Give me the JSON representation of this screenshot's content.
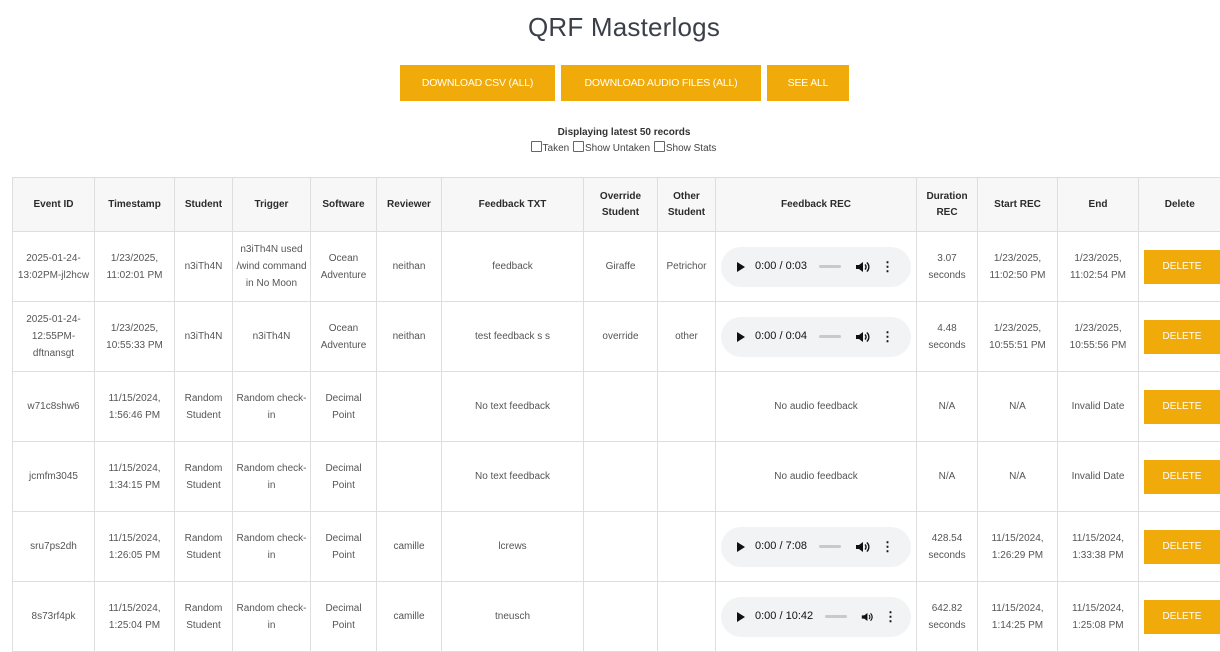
{
  "page": {
    "title": "QRF Masterlogs"
  },
  "toolbar": {
    "download_csv": "DOWNLOAD CSV (ALL)",
    "download_audio": "DOWNLOAD AUDIO FILES (ALL)",
    "see_all": "SEE ALL"
  },
  "info": {
    "displaying": "Displaying latest 50 records",
    "filters": {
      "taken": "Taken",
      "show_untaken": "Show Untaken",
      "show_stats": "Show Stats"
    }
  },
  "colors": {
    "accent": "#f0ab0b",
    "header_bg": "#f7f7f7",
    "player_bg": "#f1f3f4"
  },
  "table": {
    "headers": {
      "event_id": "Event ID",
      "timestamp": "Timestamp",
      "student": "Student",
      "trigger": "Trigger",
      "software": "Software",
      "reviewer": "Reviewer",
      "feedback_txt": "Feedback TXT",
      "override_student": "Override Student",
      "other_student": "Other Student",
      "feedback_rec": "Feedback REC",
      "duration_rec": "Duration REC",
      "start_rec": "Start REC",
      "end": "End",
      "delete": "Delete"
    },
    "delete_label": "DELETE",
    "rows": [
      {
        "event_id": "2025-01-24-13:02PM-jl2hcw",
        "timestamp": "1/23/2025, 11:02:01 PM",
        "student": "n3iTh4N",
        "trigger": "n3iTh4N used /wind command in No Moon",
        "software": "Ocean Adventure",
        "reviewer": "neithan",
        "feedback_txt": "feedback",
        "override_student": "Giraffe",
        "other_student": "Petrichor",
        "audio": {
          "time": "0:00 / 0:03",
          "progress": 0
        },
        "no_audio": "",
        "duration": "3.07 seconds",
        "start": "1/23/2025, 11:02:50 PM",
        "end": "1/23/2025, 11:02:54 PM"
      },
      {
        "event_id": "2025-01-24-12:55PM-dftnansgt",
        "timestamp": "1/23/2025, 10:55:33 PM",
        "student": "n3iTh4N",
        "trigger": "n3iTh4N",
        "software": "Ocean Adventure",
        "reviewer": "neithan",
        "feedback_txt": "test feedback s s",
        "override_student": "override",
        "other_student": "other",
        "audio": {
          "time": "0:00 / 0:04",
          "progress": 0
        },
        "no_audio": "",
        "duration": "4.48 seconds",
        "start": "1/23/2025, 10:55:51 PM",
        "end": "1/23/2025, 10:55:56 PM"
      },
      {
        "event_id": "w71c8shw6",
        "timestamp": "11/15/2024, 1:56:46 PM",
        "student": "Random Student",
        "trigger": "Random check-in",
        "software": "Decimal Point",
        "reviewer": "",
        "feedback_txt": "No text feedback",
        "override_student": "",
        "other_student": "",
        "audio": null,
        "no_audio": "No audio feedback",
        "duration": "N/A",
        "start": "N/A",
        "end": "Invalid Date"
      },
      {
        "event_id": "jcmfm3045",
        "timestamp": "11/15/2024, 1:34:15 PM",
        "student": "Random Student",
        "trigger": "Random check-in",
        "software": "Decimal Point",
        "reviewer": "",
        "feedback_txt": "No text feedback",
        "override_student": "",
        "other_student": "",
        "audio": null,
        "no_audio": "No audio feedback",
        "duration": "N/A",
        "start": "N/A",
        "end": "Invalid Date"
      },
      {
        "event_id": "sru7ps2dh",
        "timestamp": "11/15/2024, 1:26:05 PM",
        "student": "Random Student",
        "trigger": "Random check-in",
        "software": "Decimal Point",
        "reviewer": "camille",
        "feedback_txt": "lcrews",
        "override_student": "",
        "other_student": "",
        "audio": {
          "time": "0:00 / 7:08",
          "progress": 0
        },
        "no_audio": "",
        "duration": "428.54 seconds",
        "start": "11/15/2024, 1:26:29 PM",
        "end": "11/15/2024, 1:33:38 PM"
      },
      {
        "event_id": "8s73rf4pk",
        "timestamp": "11/15/2024, 1:25:04 PM",
        "student": "Random Student",
        "trigger": "Random check-in",
        "software": "Decimal Point",
        "reviewer": "camille",
        "feedback_txt": "tneusch",
        "override_student": "",
        "other_student": "",
        "audio": {
          "time": "0:00 / 10:42",
          "progress": 0
        },
        "no_audio": "",
        "duration": "642.82 seconds",
        "start": "11/15/2024, 1:14:25 PM",
        "end": "11/15/2024, 1:25:08 PM"
      }
    ]
  }
}
